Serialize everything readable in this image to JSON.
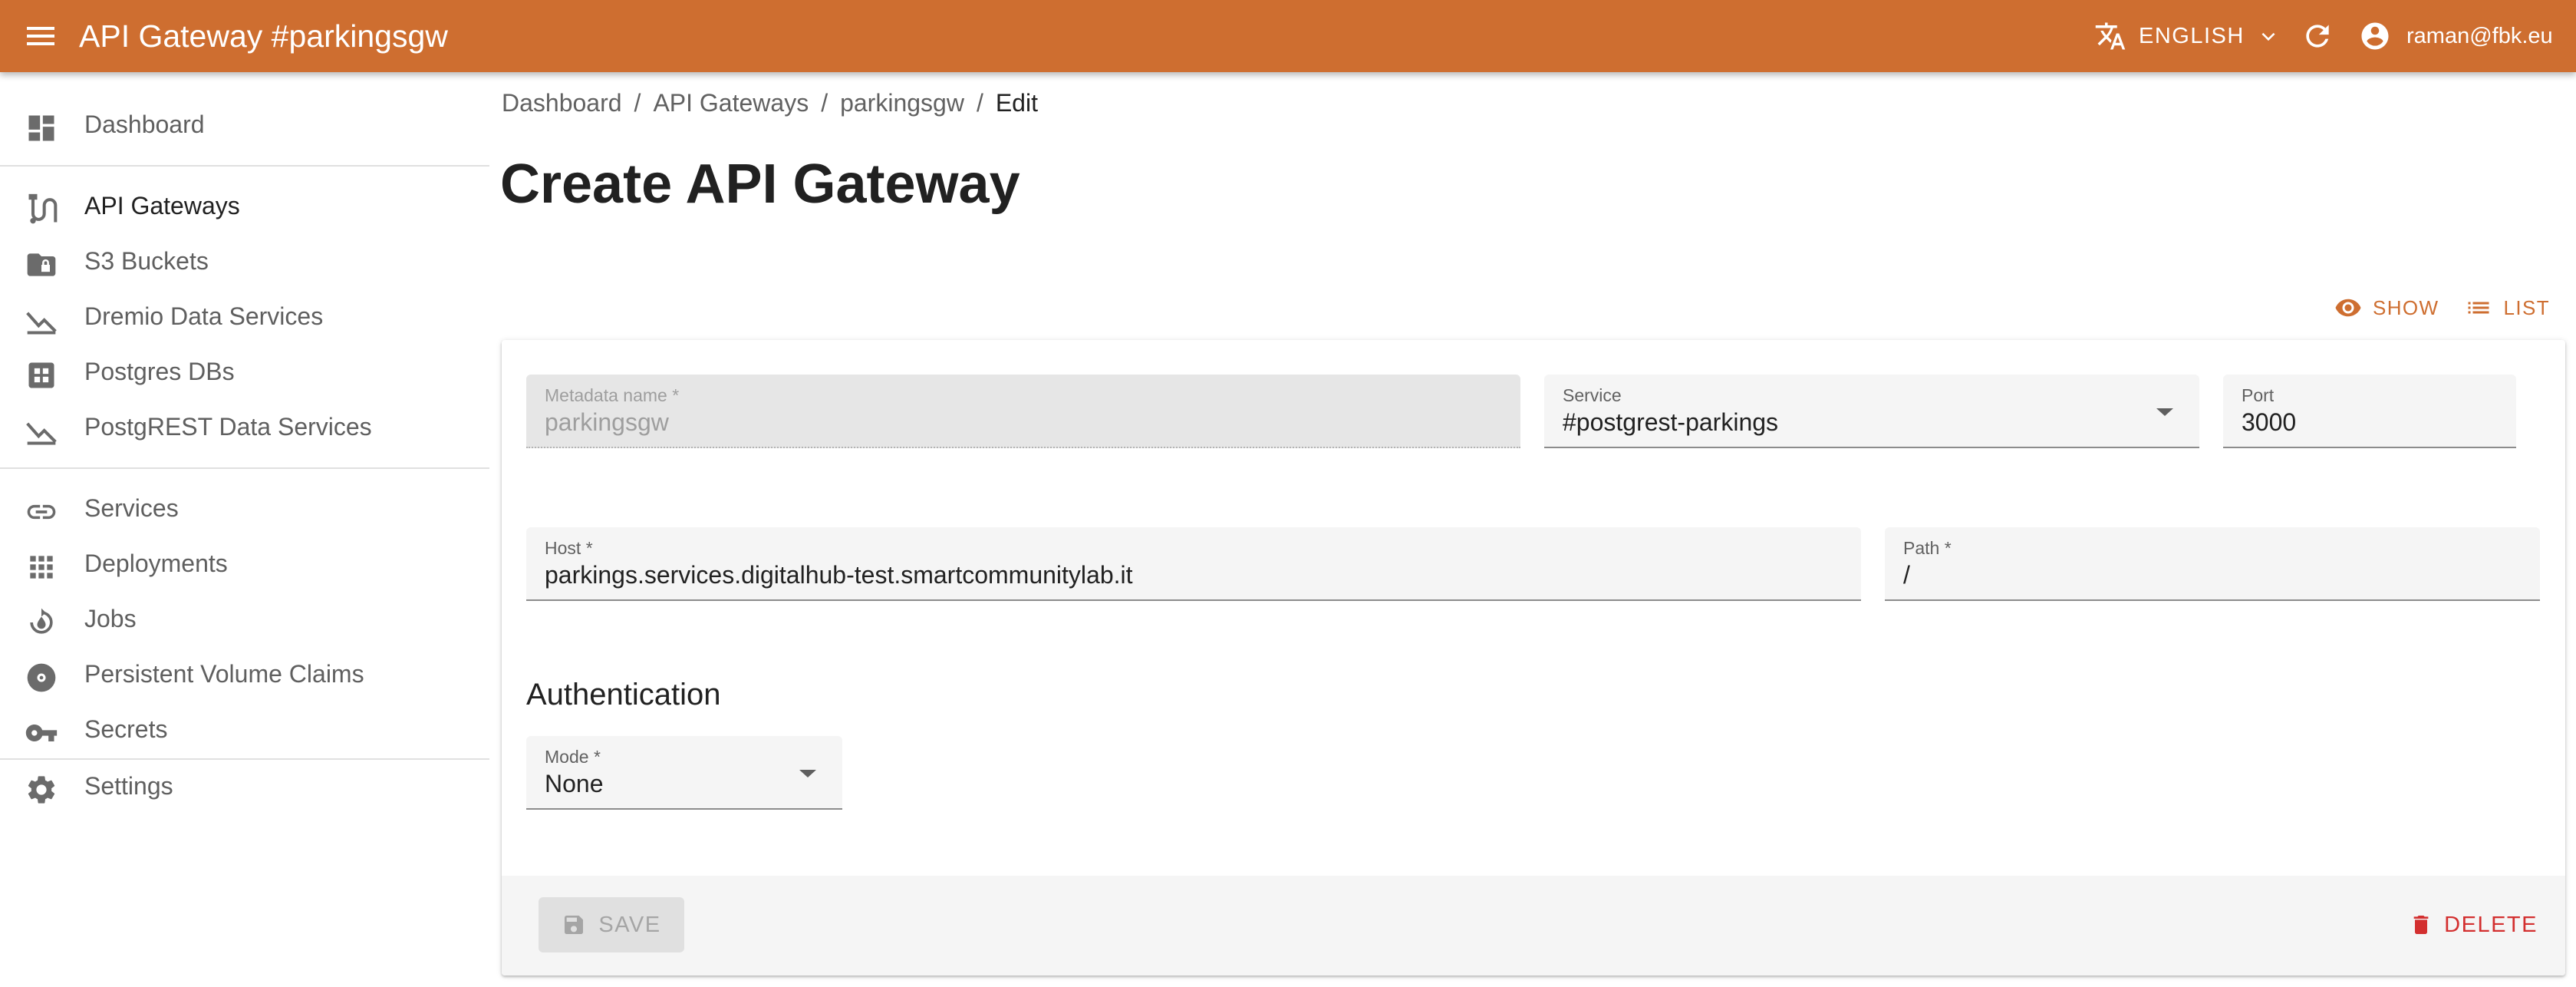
{
  "appbar": {
    "title": "API Gateway #parkingsgw",
    "language": "ENGLISH",
    "user": "raman@fbk.eu"
  },
  "sidebar": {
    "items": [
      {
        "label": "Dashboard",
        "icon": "dashboard-icon"
      },
      {
        "label": "API Gateways",
        "icon": "api-gateway-icon"
      },
      {
        "label": "S3 Buckets",
        "icon": "folder-lock-icon"
      },
      {
        "label": "Dremio Data Services",
        "icon": "chart-icon"
      },
      {
        "label": "Postgres DBs",
        "icon": "database-grid-icon"
      },
      {
        "label": "PostgREST Data Services",
        "icon": "chart-icon"
      },
      {
        "label": "Services",
        "icon": "link-icon"
      },
      {
        "label": "Deployments",
        "icon": "apps-grid-icon"
      },
      {
        "label": "Jobs",
        "icon": "jobs-icon"
      },
      {
        "label": "Persistent Volume Claims",
        "icon": "disc-icon"
      },
      {
        "label": "Secrets",
        "icon": "key-icon"
      },
      {
        "label": "Settings",
        "icon": "gear-icon"
      }
    ]
  },
  "breadcrumb": {
    "items": [
      "Dashboard",
      "API Gateways",
      "parkingsgw"
    ],
    "separator": "/",
    "current": "Edit"
  },
  "page": {
    "title": "Create API Gateway",
    "show_label": "SHOW",
    "list_label": "LIST"
  },
  "form": {
    "metadata_name": {
      "label": "Metadata name",
      "required": "*",
      "value": "parkingsgw"
    },
    "service": {
      "label": "Service",
      "value": "#postgrest-parkings"
    },
    "port": {
      "label": "Port",
      "value": "3000"
    },
    "host": {
      "label": "Host",
      "required": "*",
      "value": "parkings.services.digitalhub-test.smartcommunitylab.it"
    },
    "path": {
      "label": "Path",
      "required": "*",
      "value": "/"
    },
    "auth_title": "Authentication",
    "mode": {
      "label": "Mode",
      "required": "*",
      "value": "None"
    }
  },
  "toolbar": {
    "save_label": "SAVE",
    "delete_label": "DELETE"
  },
  "colors": {
    "primary": "#ce6e30",
    "danger": "#d32f2f"
  }
}
